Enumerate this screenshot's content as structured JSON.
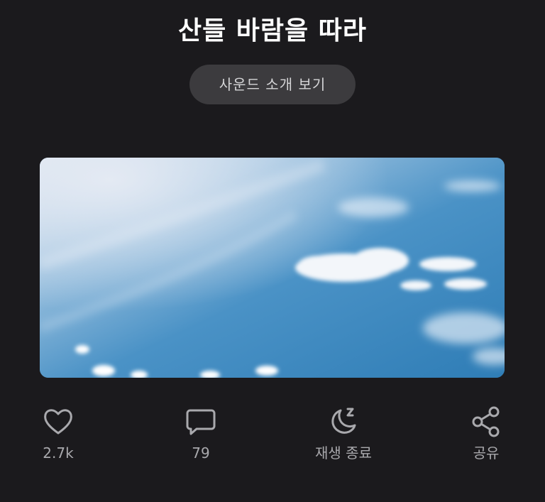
{
  "header": {
    "title": "산들 바람을 따라",
    "intro_button_label": "사운드 소개 보기"
  },
  "cover": {
    "description_icon": "sky-clouds-image"
  },
  "actions": [
    {
      "icon": "heart-icon",
      "label": "2.7k"
    },
    {
      "icon": "comment-icon",
      "label": "79"
    },
    {
      "icon": "moon-sleep-icon",
      "label": "재생 종료"
    },
    {
      "icon": "share-icon",
      "label": "공유"
    }
  ],
  "colors": {
    "background": "#1b1a1d",
    "button_bg": "#3c3b3e",
    "icon": "#a9a9ad",
    "sky": "#3f88bd"
  }
}
